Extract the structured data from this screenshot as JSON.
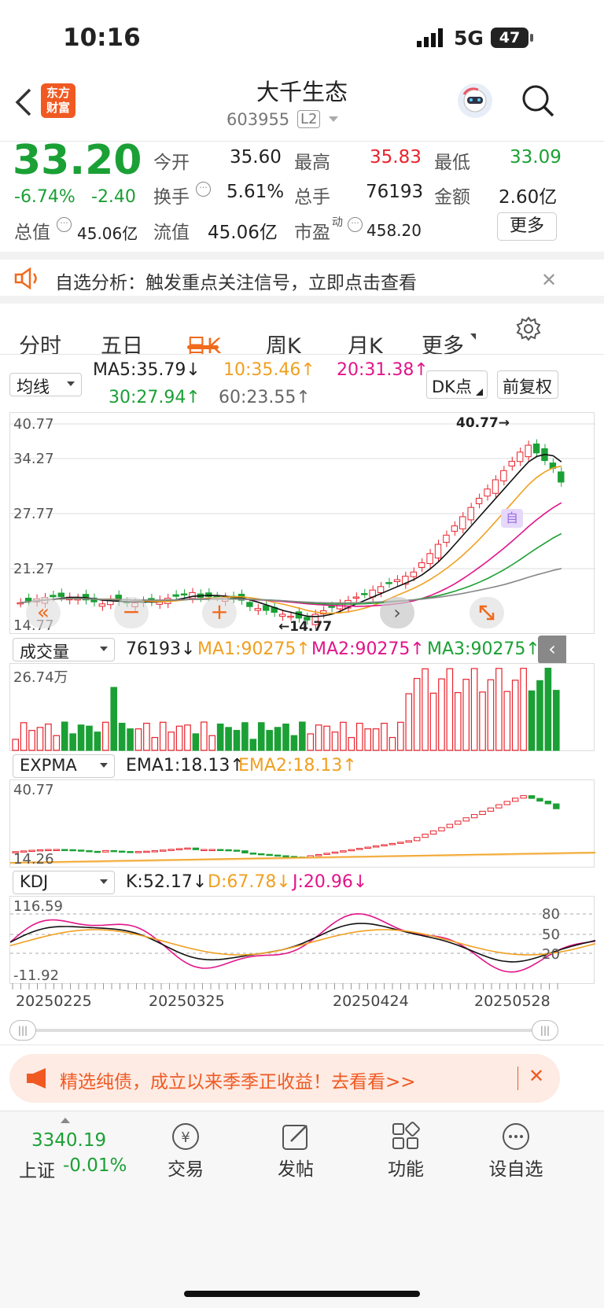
{
  "status": {
    "time": "10:16",
    "network": "5G",
    "battery": "47"
  },
  "header": {
    "title": "大千生态",
    "code": "603955",
    "level": "L2",
    "logo_line1": "东方",
    "logo_line2": "财富"
  },
  "quote": {
    "price": "33.20",
    "change_pct": "-6.74%",
    "change": "-2.40",
    "open_label": "今开",
    "open": "35.60",
    "high_label": "最高",
    "high": "35.83",
    "low_label": "最低",
    "low": "33.09",
    "turnover_label": "换手",
    "turnover": "5.61%",
    "volume_label": "总手",
    "volume": "76193",
    "amount_label": "金额",
    "amount": "2.60亿",
    "mktcap_label": "总值",
    "mktcap": "45.06亿",
    "float_label": "流值",
    "float": "45.06亿",
    "pe_label": "市盈",
    "pe_sup": "动",
    "pe": "458.20",
    "more_label": "更多"
  },
  "banner": {
    "text": "自选分析：触发重点关注信号，立即点击查看"
  },
  "tabs": [
    "分时",
    "五日",
    "日K",
    "周K",
    "月K",
    "更多"
  ],
  "active_tab": "日K",
  "ma": {
    "selector": "均线",
    "ma5": "MA5:35.79↓",
    "ma10": "10:35.46↑",
    "ma20": "20:31.38↑",
    "ma30": "30:27.94↑",
    "ma60": "60:23.55↑",
    "dk_label": "DK点",
    "fq_label": "前复权"
  },
  "kline": {
    "y_labels": [
      "40.77",
      "34.27",
      "27.77",
      "21.27",
      "14.77"
    ],
    "high_mark": "40.77→",
    "low_mark": "←14.77",
    "mark_zi": "自"
  },
  "volume": {
    "selector": "成交量",
    "value": "76193↓",
    "ma1": "MA1:90275↑",
    "ma2": "MA2:90275↑",
    "ma3": "MA3:90275↑",
    "max_label": "26.74万"
  },
  "expma": {
    "selector": "EXPMA",
    "ema1": "EMA1:18.13↑",
    "ema2": "EMA2:18.13↑",
    "max_label": "40.77",
    "min_label": "14.26"
  },
  "kdj": {
    "selector": "KDJ",
    "k": "K:52.17↓",
    "d": "D:67.78↓",
    "j": "J:20.96↓",
    "max_label": "116.59",
    "min_label": "-11.92",
    "levels": [
      "80",
      "50",
      "20"
    ]
  },
  "dates": [
    "20250225",
    "20250325",
    "20250424",
    "20250528"
  ],
  "promo": {
    "text": "精选纯债，成立以来季季正收益！去看看>>"
  },
  "bottom": {
    "index_value": "3340.19",
    "index_name": "上证",
    "index_change": "-0.01%",
    "nav": [
      "交易",
      "发帖",
      "功能",
      "设自选"
    ]
  },
  "colors": {
    "up": "#e8232c",
    "down": "#1ba035",
    "accent": "#f06a1c"
  }
}
